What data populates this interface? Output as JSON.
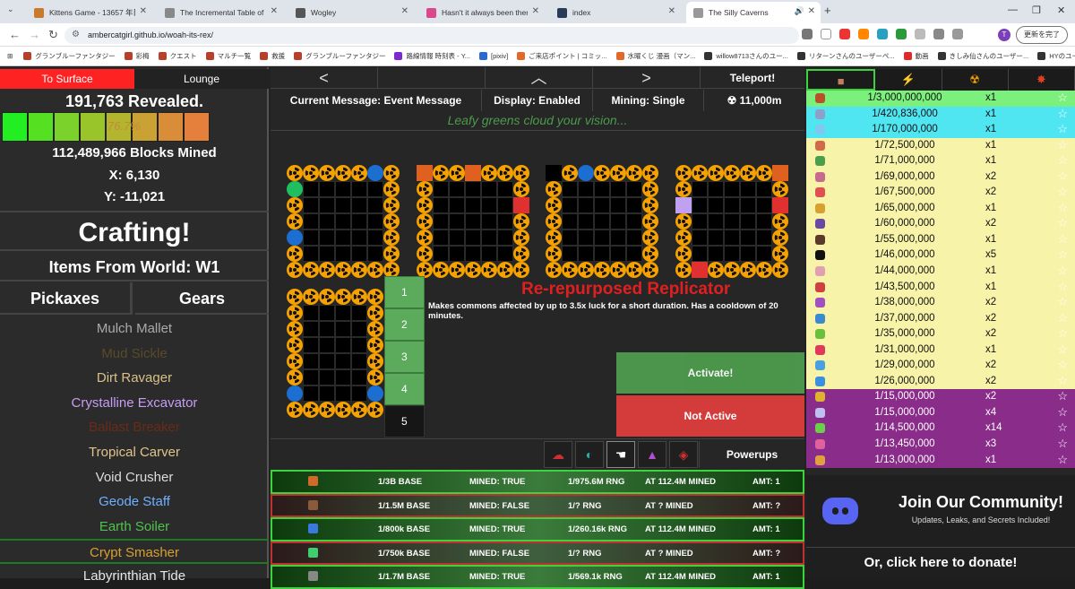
{
  "browser": {
    "tabs": [
      {
        "title": "Kittens Game - 13657 年目 - 冬",
        "color": "#c97a2b"
      },
      {
        "title": "The Incremental Table of Eleme",
        "color": "#888888"
      },
      {
        "title": "Wogley",
        "color": "#555555"
      },
      {
        "title": "Hasn't it always been there?",
        "color": "#d94a8c"
      },
      {
        "title": "index",
        "color": "#2a3b5a"
      },
      {
        "title": "The Silly Caverns",
        "color": "#999999"
      }
    ],
    "url": "ambercatgirl.github.io/woah-its-rex/",
    "update_label": "更新を完了",
    "profile_initial": "T",
    "bookmarks": [
      "グランブルーファンタジー",
      "彩梅",
      "クエスト",
      "マルチ一覧",
      "救援",
      "グランブルーファンタジー",
      "路線情報 時刻表 - Y...",
      "[pixiv]",
      "ご来店ポイント | コミッ...",
      "水曜くじ 漫画（マン...",
      "willow8713さんのユー...",
      "リターンさんのユーザーペ...",
      "動画",
      "きしみ仙さんのユーザー...",
      "HYのユーザーページ..."
    ]
  },
  "left": {
    "to_surface": "To Surface",
    "lounge": "Lounge",
    "revealed": "191,763 Revealed.",
    "progress_label": "76.7%",
    "progress_colors": [
      "#22ee22",
      "#55e022",
      "#7ad22a",
      "#99c42a",
      "#b3b52f",
      "#c9a233",
      "#d98d38",
      "#e4803c"
    ],
    "blocks_mined": "112,489,966 Blocks Mined",
    "x": "X: 6,130",
    "y": "Y: -11,021",
    "crafting": "Crafting!",
    "items_from_world": "Items From World: W1",
    "tab_pickaxes": "Pickaxes",
    "tab_gears": "Gears",
    "pickaxes": [
      {
        "name": "Mulch Mallet",
        "color": "#aaaaaa"
      },
      {
        "name": "Mud Sickle",
        "color": "#5a4a2a"
      },
      {
        "name": "Dirt Ravager",
        "color": "#d8c08a"
      },
      {
        "name": "Crystalline Excavator",
        "color": "#c79df5"
      },
      {
        "name": "Ballast Breaker",
        "color": "#6b2a16"
      },
      {
        "name": "Tropical Carver",
        "color": "#e0c48a"
      },
      {
        "name": "Void Crusher",
        "color": "#dddddd"
      },
      {
        "name": "Geode Staff",
        "color": "#6fb0ff"
      },
      {
        "name": "Earth Soiler",
        "color": "#4ec24e"
      },
      {
        "name": "Crypt Smasher",
        "color": "#d8a030"
      },
      {
        "name": "Labyrinthian Tide",
        "color": "#e8e8e8"
      }
    ]
  },
  "center": {
    "nav_prev": "<",
    "nav_up": "︿",
    "nav_next": ">",
    "teleport": "Teleport!",
    "current_message": "Current Message: Event Message",
    "display": "Display: Enabled",
    "mining": "Mining: Single",
    "depth": "☢ 11,000m",
    "event_message": "Leafy greens cloud your vision...",
    "replicator_title": "Re-repurposed Replicator",
    "replicator_desc": "Makes commons affected by up to 3.5x luck for a short duration. Has a cooldown of 20 minutes.",
    "slots": [
      "1",
      "2",
      "3",
      "4",
      "5"
    ],
    "activate": "Activate!",
    "not_active": "Not Active",
    "powerups": "Powerups",
    "stats_rows": [
      {
        "base": "1/3B BASE",
        "mined": "MINED: TRUE",
        "rng": "1/975.6M RNG",
        "at": "AT 112.4M MINED",
        "amt": "AMT: 1",
        "icon": "#d06a28",
        "ok": true
      },
      {
        "base": "1/1.5M BASE",
        "mined": "MINED: FALSE",
        "rng": "1/? RNG",
        "at": "AT ? MINED",
        "amt": "AMT: ?",
        "icon": "#8a5a3a",
        "ok": false
      },
      {
        "base": "1/800k BASE",
        "mined": "MINED: TRUE",
        "rng": "1/260.16k RNG",
        "at": "AT 112.4M MINED",
        "amt": "AMT: 1",
        "icon": "#3a7adf",
        "ok": true
      },
      {
        "base": "1/750k BASE",
        "mined": "MINED: FALSE",
        "rng": "1/? RNG",
        "at": "AT ? MINED",
        "amt": "AMT: ?",
        "icon": "#3fcf6f",
        "ok": false
      },
      {
        "base": "1/1.7M BASE",
        "mined": "MINED: TRUE",
        "rng": "1/569.1k RNG",
        "at": "AT 112.4M MINED",
        "amt": "AMT: 1",
        "icon": "#888888",
        "ok": true
      }
    ]
  },
  "right": {
    "tabs": [
      "■",
      "⚡",
      "☢",
      "✸"
    ],
    "ores": [
      {
        "rate": "1/3,000,000,000",
        "mult": "x1",
        "bg": "#7cf07c",
        "icon": "#b8502a"
      },
      {
        "rate": "1/420,836,000",
        "mult": "x1",
        "bg": "#4fe6f2",
        "icon": "#8ea0c8"
      },
      {
        "rate": "1/170,000,000",
        "mult": "x1",
        "bg": "#4fe6f2",
        "icon": "#7fc8f0"
      },
      {
        "rate": "1/72,500,000",
        "mult": "x1",
        "bg": "#f7f3a8",
        "icon": "#d06a4a"
      },
      {
        "rate": "1/71,000,000",
        "mult": "x1",
        "bg": "#f7f3a8",
        "icon": "#4aa04a"
      },
      {
        "rate": "1/69,000,000",
        "mult": "x2",
        "bg": "#f7f3a8",
        "icon": "#c86a8a"
      },
      {
        "rate": "1/67,500,000",
        "mult": "x2",
        "bg": "#f7f3a8",
        "icon": "#e05050"
      },
      {
        "rate": "1/65,000,000",
        "mult": "x1",
        "bg": "#f7f3a8",
        "icon": "#d8a030"
      },
      {
        "rate": "1/60,000,000",
        "mult": "x2",
        "bg": "#f7f3a8",
        "icon": "#6a4aa0"
      },
      {
        "rate": "1/55,000,000",
        "mult": "x1",
        "bg": "#f7f3a8",
        "icon": "#5a3a2a"
      },
      {
        "rate": "1/46,000,000",
        "mult": "x5",
        "bg": "#f7f3a8",
        "icon": "#111111"
      },
      {
        "rate": "1/44,000,000",
        "mult": "x1",
        "bg": "#f7f3a8",
        "icon": "#e0a0b0"
      },
      {
        "rate": "1/43,500,000",
        "mult": "x1",
        "bg": "#f7f3a8",
        "icon": "#d04040"
      },
      {
        "rate": "1/38,000,000",
        "mult": "x2",
        "bg": "#f7f3a8",
        "icon": "#a050c0"
      },
      {
        "rate": "1/37,000,000",
        "mult": "x2",
        "bg": "#f7f3a8",
        "icon": "#3a8ad0"
      },
      {
        "rate": "1/35,000,000",
        "mult": "x2",
        "bg": "#f7f3a8",
        "icon": "#6ac03a"
      },
      {
        "rate": "1/31,000,000",
        "mult": "x1",
        "bg": "#f7f3a8",
        "icon": "#e03a5a"
      },
      {
        "rate": "1/29,000,000",
        "mult": "x2",
        "bg": "#f7f3a8",
        "icon": "#4aa0e0"
      },
      {
        "rate": "1/26,000,000",
        "mult": "x2",
        "bg": "#f7f3a8",
        "icon": "#3a90e0"
      },
      {
        "rate": "1/15,000,000",
        "mult": "x2",
        "bg": "#8a2c8a",
        "icon": "#e0b030",
        "light": true
      },
      {
        "rate": "1/15,000,000",
        "mult": "x4",
        "bg": "#8a2c8a",
        "icon": "#c0c0f0",
        "light": true
      },
      {
        "rate": "1/14,500,000",
        "mult": "x14",
        "bg": "#8a2c8a",
        "icon": "#6ad04a",
        "light": true
      },
      {
        "rate": "1/13,450,000",
        "mult": "x3",
        "bg": "#8a2c8a",
        "icon": "#e060a0",
        "light": true
      },
      {
        "rate": "1/13,000,000",
        "mult": "x1",
        "bg": "#8a2c8a",
        "icon": "#e0a040",
        "light": true
      }
    ],
    "join": "Join Our Community!",
    "join_sub": "Updates, Leaks, and Secrets Included!",
    "donate": "Or, click here to donate!"
  }
}
